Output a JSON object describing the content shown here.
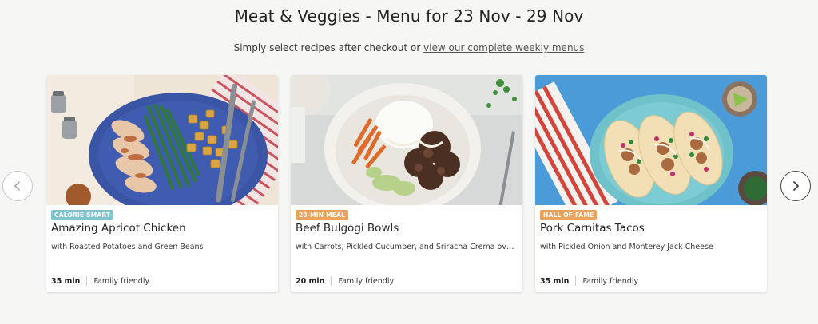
{
  "header": {
    "title": "Meat & Veggies - Menu for 23 Nov - 29 Nov",
    "subtitle_prefix": "Simply select recipes after checkout or ",
    "subtitle_link": "view our complete weekly menus"
  },
  "carousel": {
    "prev_icon": "chevron-left-icon",
    "next_icon": "chevron-right-icon"
  },
  "recipes": [
    {
      "badge": "CALORIE SMART",
      "badge_color": "#7fc3d1",
      "title": "Amazing Apricot Chicken",
      "subtitle": "with Roasted Potatoes and Green Beans",
      "time": "35 min",
      "tag": "Family friendly",
      "image": "apricot-chicken-photo"
    },
    {
      "badge": "20-MIN MEAL",
      "badge_color": "#e8a25c",
      "title": "Beef Bulgogi Bowls",
      "subtitle": "with Carrots, Pickled Cucumber, and Sriracha Crema over Rice",
      "time": "20 min",
      "tag": "Family friendly",
      "image": "beef-bulgogi-photo"
    },
    {
      "badge": "HALL OF FAME",
      "badge_color": "#e8a25c",
      "title": "Pork Carnitas Tacos",
      "subtitle": "with Pickled Onion and Monterey Jack Cheese",
      "time": "35 min",
      "tag": "Family friendly",
      "image": "pork-tacos-photo"
    }
  ]
}
